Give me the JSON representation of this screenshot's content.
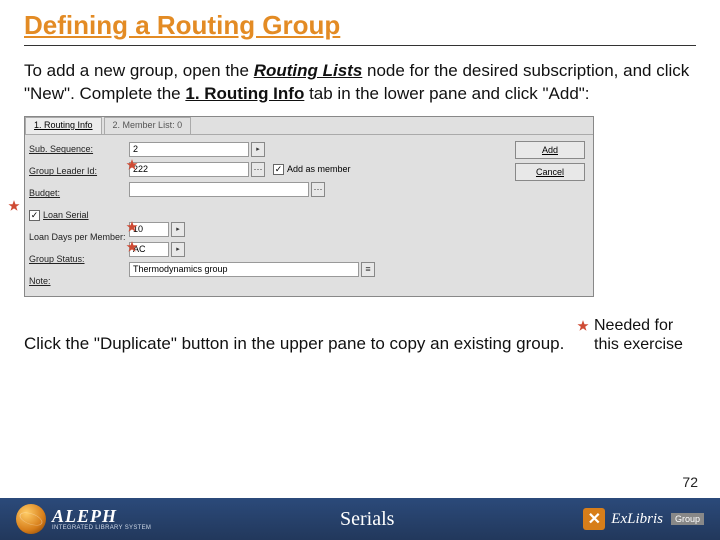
{
  "title": "Defining a Routing Group",
  "intro": {
    "pre": "To add a new group, open the ",
    "routing_lists": "Routing Lists",
    "mid1": " node for the desired subscription, and click \"New\". Complete the ",
    "routing_info": "1. Routing Info",
    "post": " tab in the lower pane and click \"Add\":"
  },
  "dialog": {
    "tabs": {
      "t1": "1. Routing Info",
      "t2": "2. Member List: 0"
    },
    "labels": {
      "sub_seq": "Sub. Sequence:",
      "leader": "Group Leader Id:",
      "budget": "Budget:",
      "loan_serial": "Loan Serial",
      "loan_days": "Loan Days per Member:",
      "status": "Group Status:",
      "note": "Note:",
      "add_as_member": "Add as member"
    },
    "values": {
      "sub_seq": "2",
      "leader": "222",
      "budget": "",
      "loan_days": "10",
      "status": "AC",
      "note": "Thermodynamics group"
    },
    "buttons": {
      "add": "Add",
      "cancel": "Cancel"
    },
    "checks": {
      "loan_serial": true,
      "add_as_member": true
    }
  },
  "legend": "Needed for this exercise",
  "closing": "Click the \"Duplicate\" button in the upper pane to copy an existing group.",
  "page_number": "72",
  "footer": {
    "aleph": "ALEPH",
    "aleph_sub": "INTEGRATED LIBRARY SYSTEM",
    "center": "Serials",
    "exlibris": "ExLibris",
    "group": "Group"
  }
}
